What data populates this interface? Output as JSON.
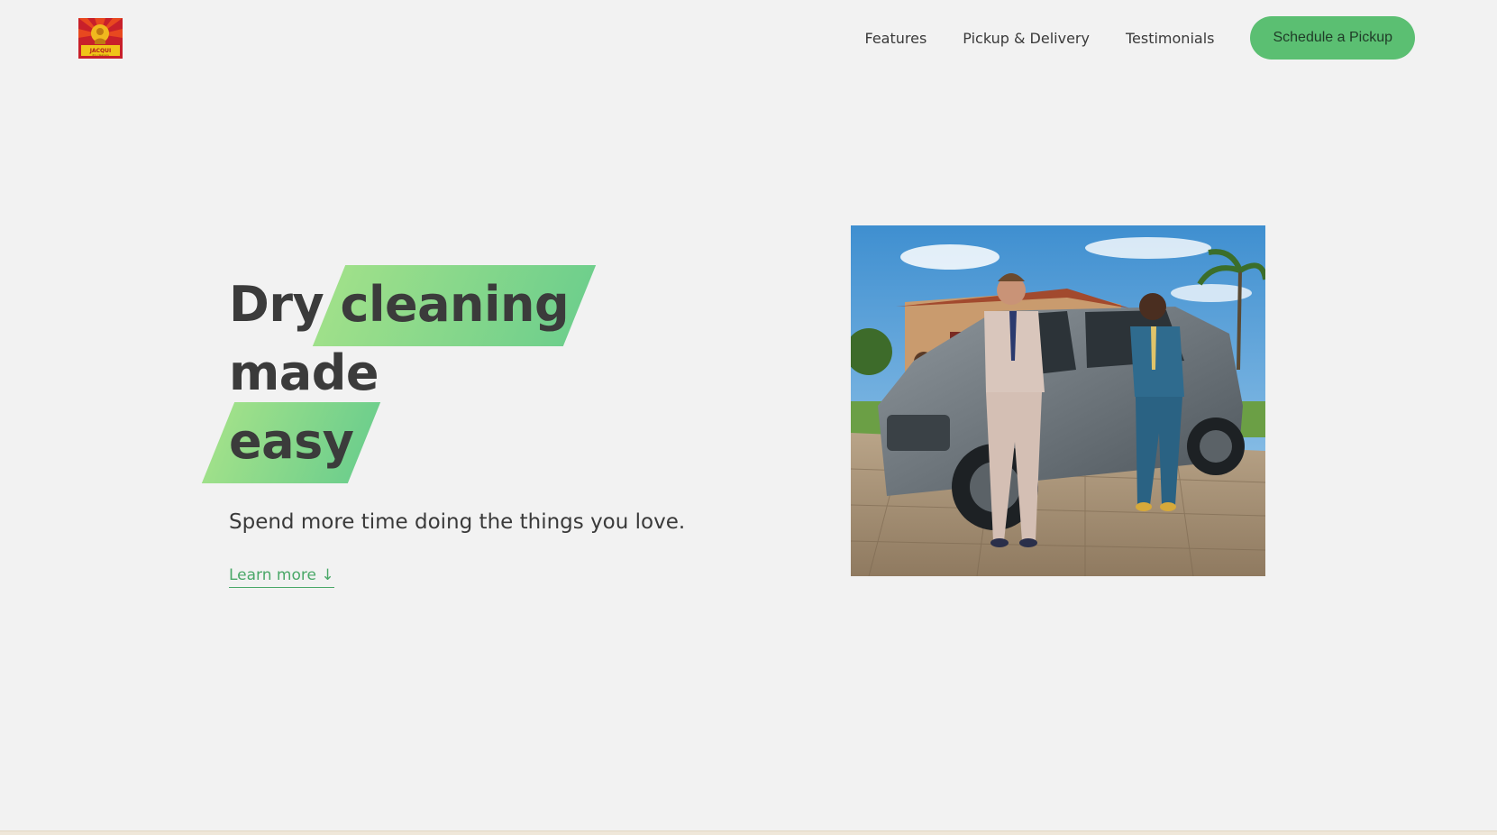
{
  "brand": {
    "logo_alt": "JACQUI logo",
    "logo_text": "JACQUI",
    "logo_subtext": "dry cleaners"
  },
  "nav": {
    "links": [
      "Features",
      "Pickup & Delivery",
      "Testimonials"
    ],
    "cta": "Schedule a Pickup"
  },
  "hero": {
    "headline_word1": "Dry",
    "headline_highlight1": "cleaning",
    "headline_word3": "made",
    "headline_highlight2": "easy",
    "subheading": "Spend more time doing the things you love.",
    "learn_more": "Learn more ↓",
    "image_alt": "Two men in suits leaning on a silver SUV in front of a house"
  },
  "colors": {
    "accent": "#5bbf72",
    "highlight_start": "#9fe08a",
    "highlight_end": "#6fcf8c",
    "background": "#f2f2f2",
    "text": "#3b3b3b"
  }
}
